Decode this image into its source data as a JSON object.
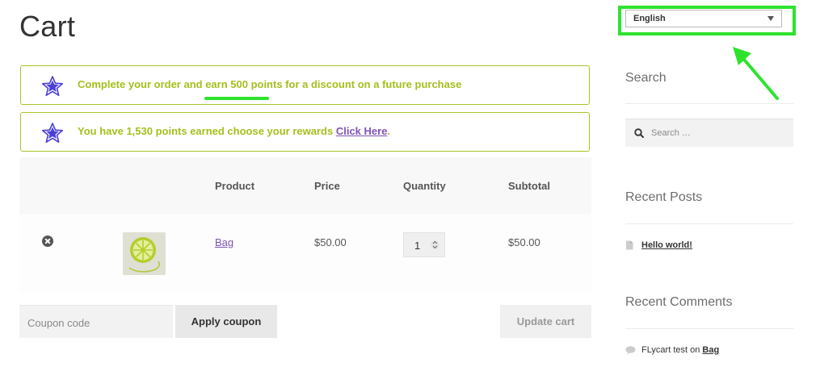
{
  "page": {
    "title": "Cart"
  },
  "notices": [
    {
      "text_before": "Complete your order and earn 500 points for a discount on a future purchase",
      "link": ""
    },
    {
      "text_before": "You have 1,530 points earned choose your rewards ",
      "link": "Click Here",
      "text_after": "."
    }
  ],
  "table": {
    "headers": [
      "Product",
      "Price",
      "Quantity",
      "Subtotal"
    ],
    "rows": [
      {
        "product": "Bag",
        "price": "$50.00",
        "quantity": "1",
        "subtotal": "$50.00"
      }
    ]
  },
  "actions": {
    "coupon_placeholder": "Coupon code",
    "apply_coupon": "Apply coupon",
    "update_cart": "Update cart"
  },
  "sidebar": {
    "language": "English",
    "search_heading": "Search",
    "search_placeholder": "Search …",
    "recent_posts_heading": "Recent Posts",
    "recent_posts": [
      "Hello world!"
    ],
    "recent_comments_heading": "Recent Comments",
    "comment_author": "FLycart test",
    "comment_on": " on ",
    "comment_post": "Bag"
  },
  "colors": {
    "notice_border": "#a6c62a",
    "notice_text": "#a4bf1b",
    "link": "#7f54b3",
    "highlight": "#2ee32e",
    "star": "#4a3fd6"
  },
  "icons": [
    "star-icon",
    "remove-icon",
    "search-icon",
    "document-icon",
    "comment-icon",
    "chevron-down-icon",
    "arrow-annotation"
  ]
}
